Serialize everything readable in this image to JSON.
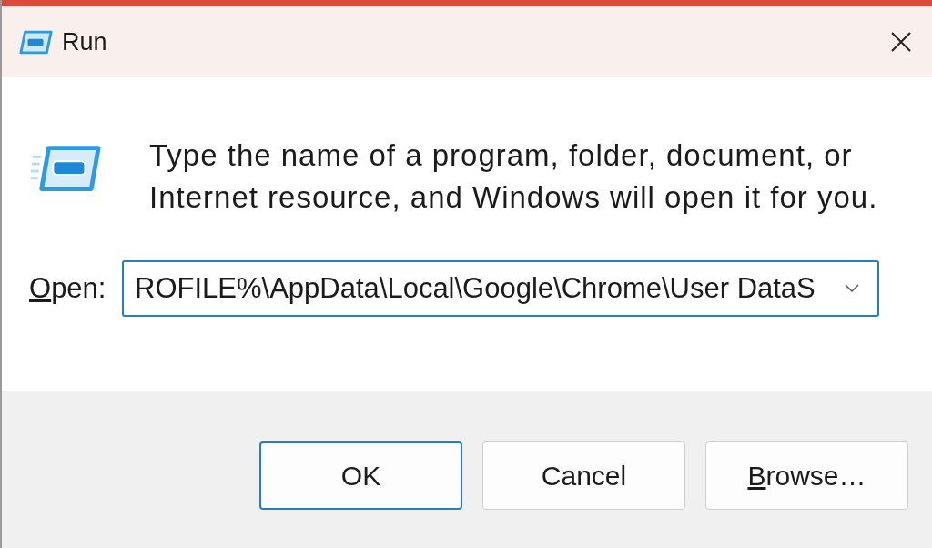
{
  "window": {
    "title": "Run"
  },
  "message": "Type the name of a program, folder, document, or Internet resource, and Windows will open it for you.",
  "open_field": {
    "label_key": "O",
    "label_rest": "pen:",
    "value": "ROFILE%\\AppData\\Local\\Google\\Chrome\\User DataS"
  },
  "buttons": [
    {
      "rest": "OK",
      "default": true
    },
    {
      "rest": "Cancel",
      "default": false
    },
    {
      "key": "B",
      "rest": "rowse…",
      "default": false
    }
  ]
}
